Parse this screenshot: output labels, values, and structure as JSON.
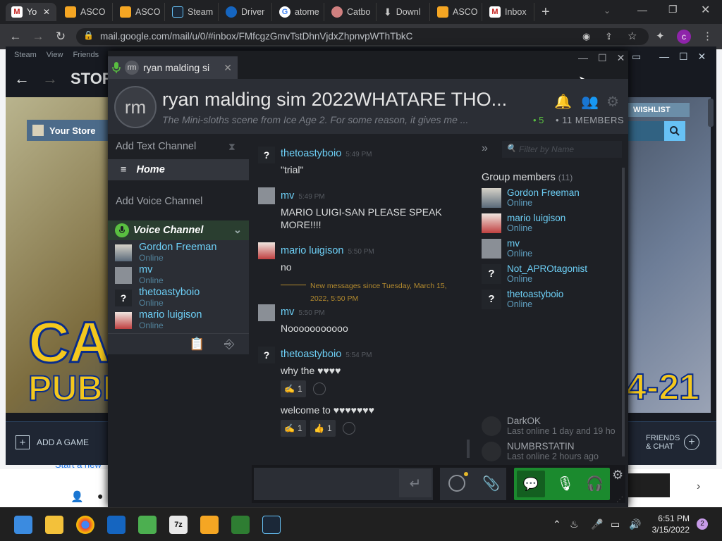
{
  "browser": {
    "tabs": [
      {
        "label": "Yo",
        "icon": "gmail-icon",
        "color": "#c5221f"
      },
      {
        "label": "ASCO",
        "icon": "ascom-icon",
        "color": "#f5a623"
      },
      {
        "label": "ASCO",
        "icon": "ascom-icon",
        "color": "#f5a623"
      },
      {
        "label": "Steam",
        "icon": "steam-icon",
        "color": "#1b2838"
      },
      {
        "label": "Driver",
        "icon": "driver-icon",
        "color": "#1565c0"
      },
      {
        "label": "atome",
        "icon": "google-icon",
        "color": "#ffffff"
      },
      {
        "label": "Catbo",
        "icon": "catbox-icon",
        "color": "#d08080"
      },
      {
        "label": "Downl",
        "icon": "download-icon",
        "color": "#9aa0a6"
      },
      {
        "label": "ASCO",
        "icon": "ascom-icon",
        "color": "#f5a623"
      },
      {
        "label": "Inbox",
        "icon": "gmail-icon",
        "color": "#c5221f"
      }
    ],
    "url": "mail.google.com/mail/u/0/#inbox/FMfcgzGmvTstDhnVjdxZhpnvpWThTbkC",
    "profile_initial": "c"
  },
  "steam": {
    "menu": [
      "Steam",
      "View",
      "Friends"
    ],
    "store_label": "STORE",
    "your_store": "Your Store",
    "wishlist": "WISHLIST",
    "add_game": "ADD A GAME",
    "friends_chat_1": "FRIENDS",
    "friends_chat_2": "& CHAT",
    "banner_text_1": "CA",
    "banner_text_2": "PUBL",
    "banner_text_3": "4-21"
  },
  "gmail": {
    "start_new": "Start a new"
  },
  "chat": {
    "tab_avatar": "rm",
    "tab_title": "ryan malding si",
    "group_avatar": "rm",
    "group_title": "ryan malding sim 2022WHATARE THO...",
    "tagline": "The Mini-sloths scene from Ice Age 2. For some reason, it gives me ...",
    "online_count": "• 5",
    "members_count": "• 11 MEMBERS",
    "add_text_channel": "Add Text Channel",
    "home": "Home",
    "add_voice_channel": "Add Voice Channel",
    "voice_channel": "Voice Channel",
    "voice_members": [
      {
        "name": "Gordon Freeman",
        "status": "Online",
        "avatar": "gordon"
      },
      {
        "name": "mv",
        "status": "Online",
        "avatar": "mv"
      },
      {
        "name": "thetoastyboio",
        "status": "Online",
        "avatar": "unknown"
      },
      {
        "name": "mario luigison",
        "status": "Online",
        "avatar": "mario"
      }
    ],
    "messages": [
      {
        "author": "thetoastyboio",
        "time": "5:49 PM",
        "text": "\"trial\""
      },
      {
        "author": "mv",
        "time": "5:49 PM",
        "text": "MARIO LUIGI-SAN PLEASE SPEAK MORE!!!!"
      },
      {
        "author": "mario luigison",
        "time": "5:50 PM",
        "text": "no"
      },
      {
        "author": "mv",
        "time": "5:50 PM",
        "text": "Nooooooooooo"
      },
      {
        "author": "thetoastyboio",
        "time": "5:54 PM",
        "text": "why the ♥♥♥♥",
        "text2": "welcome to ♥♥♥♥♥♥♥"
      }
    ],
    "new_messages_sep": "New messages since Tuesday, March 15, 2022, 5:50 PM",
    "reaction_counts": [
      "1",
      "1",
      "1"
    ],
    "filter_placeholder": "Filter by Name",
    "group_members_label": "Group members",
    "group_members_count": "(11)",
    "members": [
      {
        "name": "Gordon Freeman",
        "status": "Online",
        "avatar": "gordon"
      },
      {
        "name": "mario luigison",
        "status": "Online",
        "avatar": "mario"
      },
      {
        "name": "mv",
        "status": "Online",
        "avatar": "mv"
      },
      {
        "name": "Not_APROtagonist",
        "status": "Online",
        "avatar": "unknown"
      },
      {
        "name": "thetoastyboio",
        "status": "Online",
        "avatar": "unknown"
      }
    ],
    "offline_members": [
      {
        "name": "DarkOK",
        "status": "Last online 1 day and 19 ho"
      },
      {
        "name": "NUMBRSTATIN",
        "status": "Last online 2 hours ago"
      }
    ]
  },
  "taskbar": {
    "time": "6:51 PM",
    "date": "3/15/2022",
    "notifications": "2"
  }
}
